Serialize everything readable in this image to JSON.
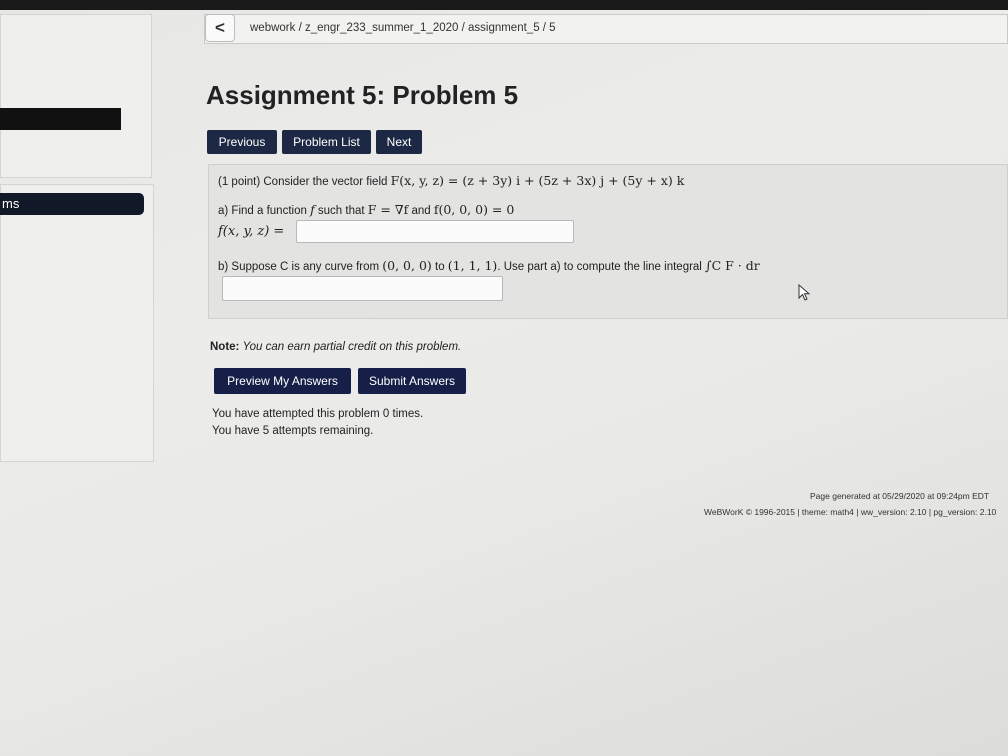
{
  "breadcrumb": {
    "back_label": "<",
    "path": "webwork / z_engr_233_summer_1_2020 / assignment_5 / 5"
  },
  "sidebar": {
    "item_label": "ms"
  },
  "page_title": "Assignment 5: Problem 5",
  "nav": {
    "previous": "Previous",
    "problem_list": "Problem List",
    "next": "Next"
  },
  "problem": {
    "points": "(1 point) Consider the vector field",
    "field": "F(x, y, z) = (z + 3y) i + (5z + 3x) j + (5y + x) k",
    "part_a_prefix": "a) Find a function",
    "part_a_f": "f",
    "part_a_mid": "such that",
    "part_a_eq": "F = ∇f",
    "part_a_and": "and",
    "part_a_cond": "f(0, 0, 0) = 0",
    "f_label": "f(x, y, z) =",
    "part_b_prefix": "b) Suppose C is any curve from",
    "part_b_from": "(0, 0, 0)",
    "part_b_to_word": "to",
    "part_b_to": "(1, 1, 1)",
    "part_b_suffix": ". Use part a) to compute the line integral",
    "integral": "∫C F · dr",
    "answer_a_value": "",
    "answer_b_value": ""
  },
  "note": {
    "label": "Note:",
    "text": "You can earn partial credit on this problem."
  },
  "buttons": {
    "preview": "Preview My Answers",
    "submit": "Submit Answers"
  },
  "attempts": {
    "line1": "You have attempted this problem 0 times.",
    "line2": "You have 5 attempts remaining."
  },
  "footer": {
    "generated": "Page generated at 05/29/2020 at 09:24pm EDT",
    "copyright": "WeBWorK © 1996-2015 | theme: math4 | ww_version: 2.10 | pg_version: 2.10"
  },
  "colors": {
    "nav_button": "#1d2944",
    "submit_button": "#151f48",
    "sidebar_active": "#111827"
  }
}
